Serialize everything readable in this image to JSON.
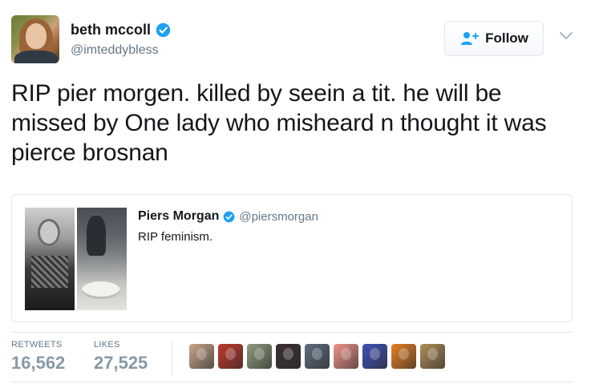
{
  "author": {
    "display_name": "beth mccoll",
    "handle": "@imteddybless",
    "verified": true
  },
  "follow_button": {
    "label": "Follow"
  },
  "tweet": {
    "text": "RIP pier morgen. killed by seein a tit. he will be missed by One lady who misheard n thought it was pierce brosnan"
  },
  "quoted_tweet": {
    "display_name": "Piers Morgan",
    "handle": "@piersmorgan",
    "verified": true,
    "text": "RIP feminism."
  },
  "stats": {
    "retweets_label": "RETWEETS",
    "retweets_value": "16,562",
    "likes_label": "LIKES",
    "likes_value": "27,525"
  },
  "likers": [
    {
      "name": "liker-1",
      "color": "#c9a48a"
    },
    {
      "name": "liker-2",
      "color": "#c0392b"
    },
    {
      "name": "liker-3",
      "color": "#8e9a7b"
    },
    {
      "name": "liker-4",
      "color": "#3b2f2f"
    },
    {
      "name": "liker-5",
      "color": "#5d6d7e"
    },
    {
      "name": "liker-6",
      "color": "#f1948a"
    },
    {
      "name": "liker-7",
      "color": "#3f51b5"
    },
    {
      "name": "liker-8",
      "color": "#e67e22"
    },
    {
      "name": "liker-9",
      "color": "#b08d57"
    }
  ],
  "colors": {
    "brand_blue": "#1da1f2",
    "text": "#14171a",
    "secondary_text": "#657786",
    "border": "#e1e8ed"
  },
  "icons": {
    "verified": "verified-badge-icon",
    "follow": "add-user-icon",
    "more": "chevron-down-icon"
  }
}
